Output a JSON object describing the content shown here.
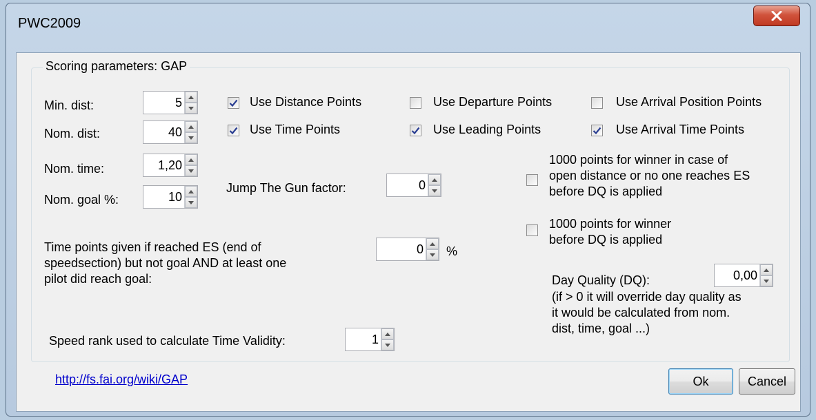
{
  "window": {
    "title": "PWC2009"
  },
  "group": {
    "title": "Scoring parameters: GAP"
  },
  "fields": {
    "min_dist": {
      "label": "Min. dist:",
      "value": "5"
    },
    "nom_dist": {
      "label": "Nom. dist:",
      "value": "40"
    },
    "nom_time": {
      "label": "Nom. time:",
      "value": "1,20"
    },
    "nom_goal": {
      "label": "Nom. goal %:",
      "value": "10"
    },
    "jtg": {
      "label": "Jump The Gun factor:",
      "value": "0"
    },
    "time_points": {
      "label_lines": [
        "Time points given if reached ES (end of",
        "speedsection) but not goal AND at least one",
        "pilot did reach goal:"
      ],
      "value": "0",
      "unit": "%"
    },
    "speed_rank": {
      "label": "Speed rank used to calculate Time Validity:",
      "value": "1"
    },
    "day_quality": {
      "label": "Day Quality (DQ):",
      "value": "0,00",
      "note_lines": [
        "(if > 0 it will override day quality as",
        "it would be calculated from nom.",
        "dist, time, goal ...)"
      ]
    }
  },
  "checkboxes": {
    "use_distance": {
      "label": "Use Distance Points",
      "checked": true
    },
    "use_departure": {
      "label": "Use Departure Points",
      "checked": false
    },
    "use_arrival_pos": {
      "label": "Use Arrival Position Points",
      "checked": false
    },
    "use_time": {
      "label": "Use Time Points",
      "checked": true
    },
    "use_leading": {
      "label": "Use Leading Points",
      "checked": true
    },
    "use_arrival_time": {
      "label": "Use Arrival Time Points",
      "checked": true
    },
    "winner_open": {
      "label_lines": [
        "1000 points for winner in case of",
        "open distance or no one reaches ES",
        "before DQ is applied"
      ],
      "checked": false
    },
    "winner_dq": {
      "label_lines": [
        "1000 points for winner",
        "before DQ is applied"
      ],
      "checked": false
    }
  },
  "link": {
    "text": "http://fs.fai.org/wiki/GAP"
  },
  "buttons": {
    "ok": "Ok",
    "cancel": "Cancel"
  },
  "icons": {
    "close": "close-icon",
    "spin_up": "arrow-up-icon",
    "spin_down": "arrow-down-icon",
    "check": "check-icon"
  }
}
